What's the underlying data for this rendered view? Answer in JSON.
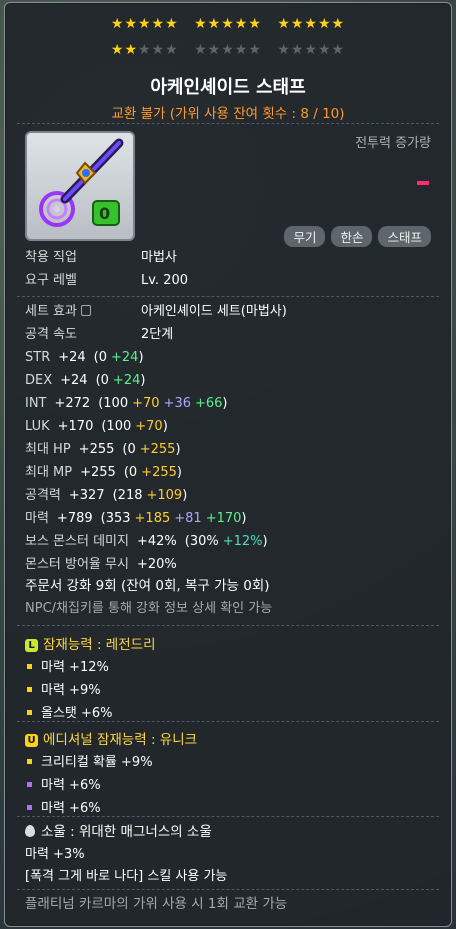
{
  "stars": {
    "row1": [
      "★★★★★",
      "★★★★★",
      "★★★★★"
    ],
    "row2_on": "★★",
    "row2_rest1": "★★★",
    "row2_g2": "★★★★★",
    "row2_g3": "★★★★★"
  },
  "item": {
    "name": "아케인셰이드 스태프",
    "trade_note": "교환 불가 (가위 사용 잔여 횟수 : 8 / 10)",
    "combat_label": "전투력 증가량",
    "tags": [
      "무기",
      "한손",
      "스태프"
    ]
  },
  "requirements": [
    {
      "label": "착용 직업",
      "value": "마법사"
    },
    {
      "label": "요구 레벨",
      "value": "Lv. 200"
    }
  ],
  "set_effect": {
    "label": "세트 효과",
    "value": "아케인셰이드 세트(마법사)"
  },
  "attack_speed": {
    "label": "공격 속도",
    "value": "2단계"
  },
  "stats": [
    {
      "name": "STR",
      "total": "+24",
      "open": "(0",
      "parts": [
        {
          "v": "+24",
          "c": "green"
        }
      ],
      "close": ")"
    },
    {
      "name": "DEX",
      "total": "+24",
      "open": "(0",
      "parts": [
        {
          "v": "+24",
          "c": "green"
        }
      ],
      "close": ")"
    },
    {
      "name": "INT",
      "total": "+272",
      "open": "(100",
      "parts": [
        {
          "v": "+70",
          "c": "yellow"
        },
        {
          "v": "+36",
          "c": "blue"
        },
        {
          "v": "+66",
          "c": "green"
        }
      ],
      "close": ")"
    },
    {
      "name": "LUK",
      "total": "+170",
      "open": "(100",
      "parts": [
        {
          "v": "+70",
          "c": "yellow"
        }
      ],
      "close": ")"
    },
    {
      "name": "최대 HP",
      "total": "+255",
      "open": "(0",
      "parts": [
        {
          "v": "+255",
          "c": "yellow"
        }
      ],
      "close": ")"
    },
    {
      "name": "최대 MP",
      "total": "+255",
      "open": "(0",
      "parts": [
        {
          "v": "+255",
          "c": "yellow"
        }
      ],
      "close": ")"
    },
    {
      "name": "공격력",
      "total": "+327",
      "open": "(218",
      "parts": [
        {
          "v": "+109",
          "c": "yellow"
        }
      ],
      "close": ")"
    },
    {
      "name": "마력",
      "total": "+789",
      "open": "(353",
      "parts": [
        {
          "v": "+185",
          "c": "yellow"
        },
        {
          "v": "+81",
          "c": "blue"
        },
        {
          "v": "+170",
          "c": "green"
        }
      ],
      "close": ")"
    },
    {
      "name": "보스 몬스터 데미지",
      "total": "+42%",
      "open": "(30%",
      "parts": [
        {
          "v": "+12%",
          "c": "teal"
        }
      ],
      "close": ")"
    },
    {
      "name": "몬스터 방어율 무시",
      "total": "+20%",
      "open": "",
      "parts": [],
      "close": ""
    }
  ],
  "enhance": {
    "line": "주문서 강화 9회 (잔여 0회, 복구 가능 0회)",
    "npc_note": "NPC/채집키를 통해 강화 정보 상세 확인 가능"
  },
  "potential": {
    "badge": "L",
    "badge_color": "#c9e833",
    "title": "잠재능력 : 레전드리",
    "dot_color": "#ffd21a",
    "lines": [
      "마력 +12%",
      "마력 +9%",
      "올스탯 +6%"
    ]
  },
  "additional": {
    "badge": "U",
    "badge_color": "#ffd21a",
    "title": "에디셔널 잠재능력 : 유니크",
    "dot_colors": [
      "#ffd21a",
      "#b36bff",
      "#b36bff"
    ],
    "lines": [
      "크리티컬 확률 +9%",
      "마력 +6%",
      "마력 +6%"
    ]
  },
  "soul": {
    "title": "소울 : 위대한 매그너스의 소울",
    "stat": "마력 +3%",
    "skill": "[폭격 그게 바로 나다] 스킬 사용 가능"
  },
  "karma_note": "플래티넘 카르마의 가위 사용 시 1회 교환 가능"
}
